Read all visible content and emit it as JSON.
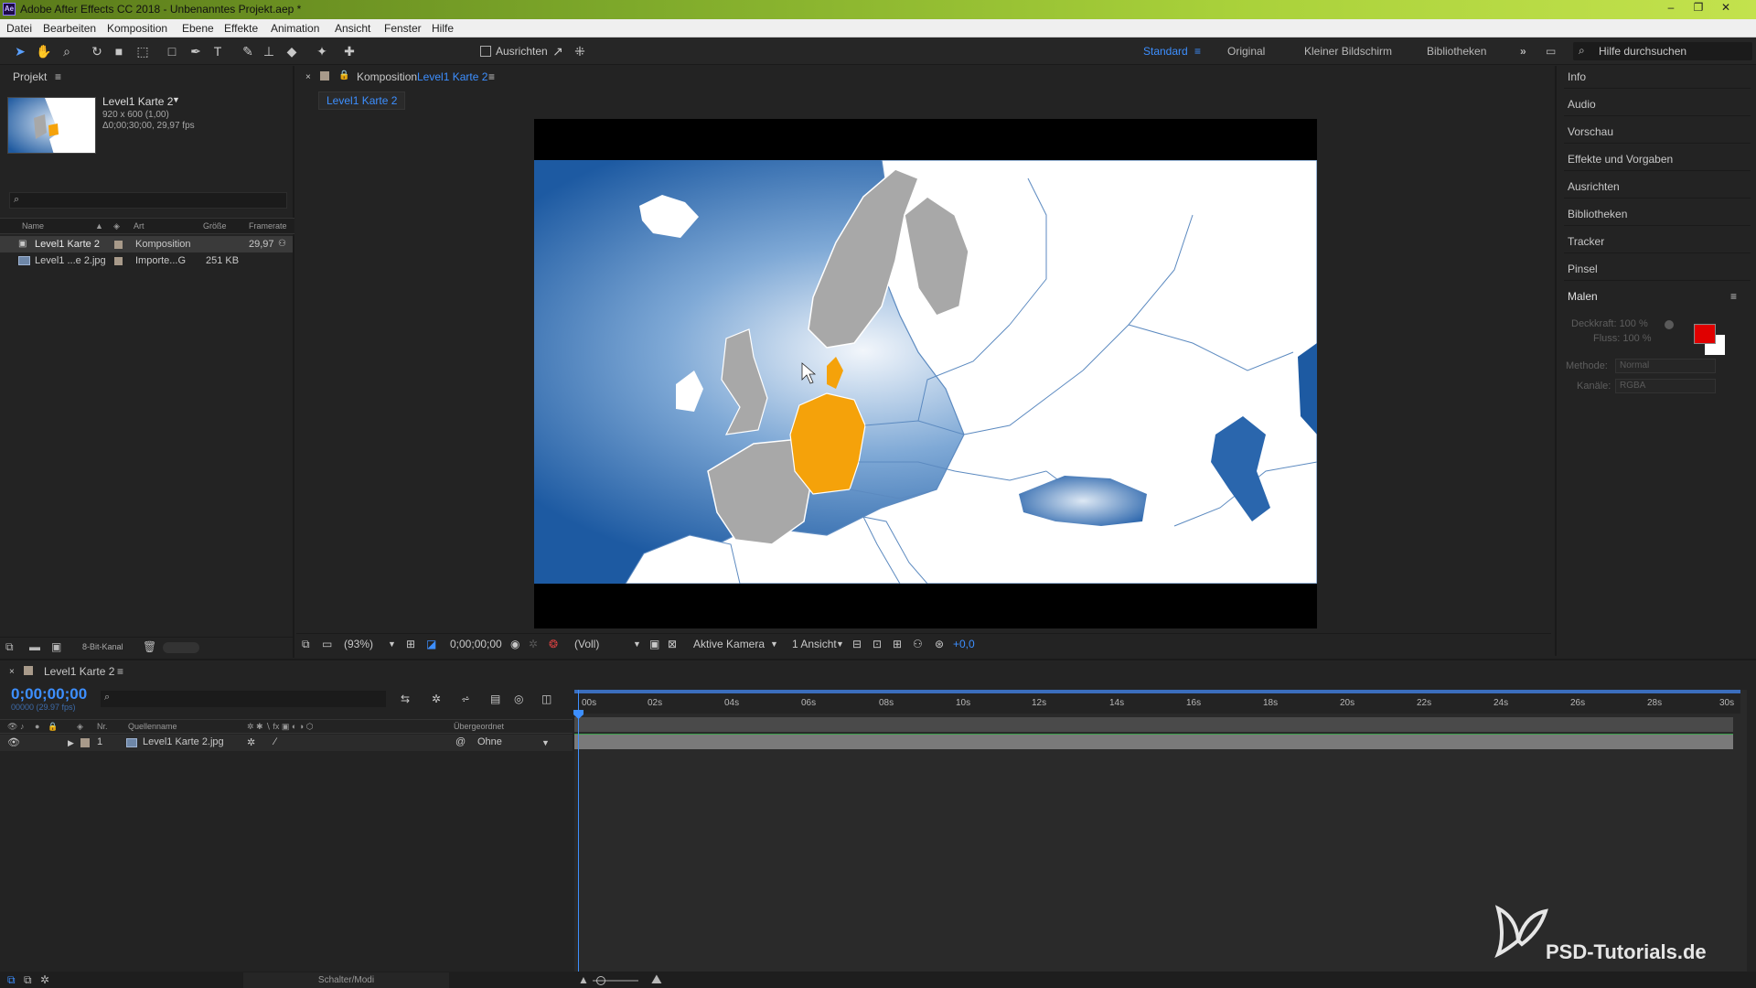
{
  "titlebar": {
    "title": "Adobe After Effects CC 2018 - Unbenanntes Projekt.aep *",
    "app_icon": "Ae"
  },
  "menu": [
    "Datei",
    "Bearbeiten",
    "Komposition",
    "Ebene",
    "Effekte",
    "Animation",
    "Ansicht",
    "Fenster",
    "Hilfe"
  ],
  "toolbar": {
    "align_label": "Ausrichten",
    "workspaces": [
      "Standard",
      "Original",
      "Kleiner Bildschirm",
      "Bibliotheken"
    ],
    "active_workspace": "Standard",
    "help_search_placeholder": "Hilfe durchsuchen"
  },
  "project": {
    "title": "Projekt",
    "selected": {
      "name": "Level1 Karte 2",
      "dims": "920 x 600 (1,00)",
      "duration": "Δ0;00;30;00, 29,97 fps"
    },
    "columns": [
      "Name",
      "Art",
      "Größe",
      "Framerate"
    ],
    "items": [
      {
        "name": "Level1 Karte 2",
        "type": "Komposition",
        "size": "",
        "framerate": "29,97"
      },
      {
        "name": "Level1 ...e 2.jpg",
        "type": "Importe...G",
        "size": "251 KB",
        "framerate": ""
      }
    ],
    "bit_depth": "8-Bit-Kanal"
  },
  "composition": {
    "panel_label": "Komposition",
    "comp_name": "Level1 Karte 2",
    "tab": "Level1 Karte 2",
    "footer": {
      "zoom": "(93%)",
      "timecode": "0;00;00;00",
      "resolution": "(Voll)",
      "camera": "Aktive Kamera",
      "views": "1 Ansicht",
      "exposure": "+0,0"
    }
  },
  "right_panel": {
    "items": [
      "Info",
      "Audio",
      "Vorschau",
      "Effekte und Vorgaben",
      "Ausrichten",
      "Bibliotheken",
      "Tracker",
      "Pinsel",
      "Malen"
    ],
    "paint": {
      "opacity": "Deckkraft: 100 %",
      "flow": "Fluss: 100 %",
      "method_label": "Methode:",
      "method": "Normal",
      "channels_label": "Kanäle:",
      "channels": "RGBA",
      "foreground_color": "#e00000",
      "background_color": "#ffffff"
    }
  },
  "timeline": {
    "comp_tab": "Level1 Karte 2",
    "time": "0;00;00;00",
    "fps": "00000 (29.97 fps)",
    "columns": {
      "nr": "Nr.",
      "source": "Quellenname",
      "parent": "Übergeordnet"
    },
    "layer": {
      "number": "1",
      "name": "Level1 Karte 2.jpg",
      "parent": "Ohne"
    },
    "ruler": [
      "00s",
      "02s",
      "04s",
      "06s",
      "08s",
      "10s",
      "12s",
      "14s",
      "16s",
      "18s",
      "20s",
      "22s",
      "24s",
      "26s",
      "28s",
      "30s"
    ],
    "modes_toggle": "Schalter/Modi"
  },
  "watermark": "PSD-Tutorials.de",
  "colors": {
    "accent": "#3d8fff",
    "germany": "#f5a20a",
    "sea": "#1f5aa0",
    "land": "#ffffff",
    "grey_country": "#a8a8a8"
  }
}
